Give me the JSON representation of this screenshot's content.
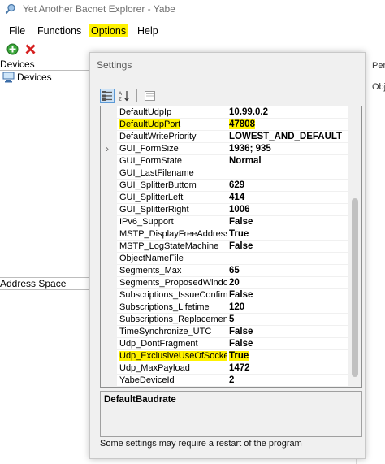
{
  "window": {
    "title": "Yet Another Bacnet Explorer - Yabe"
  },
  "menu": {
    "items": [
      {
        "label": "File",
        "highlighted": false
      },
      {
        "label": "Functions",
        "highlighted": false
      },
      {
        "label": "Options",
        "highlighted": true
      },
      {
        "label": "Help",
        "highlighted": false
      }
    ]
  },
  "toolbar": {
    "icons": [
      "add-icon",
      "delete-icon"
    ]
  },
  "left_panel": {
    "devices_header": "Devices",
    "devices_item": "Devices",
    "address_space_header": "Address Space"
  },
  "right_edge": {
    "caption_1": "Pen",
    "caption_2": "Obj"
  },
  "dialog": {
    "title": "Settings",
    "toolbar_icons": [
      "categorized-icon",
      "alphabetical-sort-icon",
      "property-pages-icon"
    ],
    "properties": [
      {
        "name": "DefaultUdpIp",
        "value": "10.99.0.2",
        "highlight": false,
        "expandable": false
      },
      {
        "name": "DefaultUdpPort",
        "value": "47808",
        "highlight": true,
        "expandable": false
      },
      {
        "name": "DefaultWritePriority",
        "value": "LOWEST_AND_DEFAULT",
        "highlight": false,
        "expandable": false
      },
      {
        "name": "GUI_FormSize",
        "value": "1936; 935",
        "highlight": false,
        "expandable": true
      },
      {
        "name": "GUI_FormState",
        "value": "Normal",
        "highlight": false,
        "expandable": false
      },
      {
        "name": "GUI_LastFilename",
        "value": "",
        "highlight": false,
        "expandable": false
      },
      {
        "name": "GUI_SplitterButtom",
        "value": "629",
        "highlight": false,
        "expandable": false
      },
      {
        "name": "GUI_SplitterLeft",
        "value": "414",
        "highlight": false,
        "expandable": false
      },
      {
        "name": "GUI_SplitterRight",
        "value": "1006",
        "highlight": false,
        "expandable": false
      },
      {
        "name": "IPv6_Support",
        "value": "False",
        "highlight": false,
        "expandable": false
      },
      {
        "name": "MSTP_DisplayFreeAddresses",
        "value": "True",
        "highlight": false,
        "expandable": false
      },
      {
        "name": "MSTP_LogStateMachine",
        "value": "False",
        "highlight": false,
        "expandable": false
      },
      {
        "name": "ObjectNameFile",
        "value": "",
        "highlight": false,
        "expandable": false
      },
      {
        "name": "Segments_Max",
        "value": "65",
        "highlight": false,
        "expandable": false
      },
      {
        "name": "Segments_ProposedWindow",
        "value": "20",
        "highlight": false,
        "expandable": false
      },
      {
        "name": "Subscriptions_IssueConfirmedNotifies",
        "value": "False",
        "highlight": false,
        "expandable": false
      },
      {
        "name": "Subscriptions_Lifetime",
        "value": "120",
        "highlight": false,
        "expandable": false
      },
      {
        "name": "Subscriptions_ReplacementPollingPeriod",
        "value": "5",
        "highlight": false,
        "expandable": false
      },
      {
        "name": "TimeSynchronize_UTC",
        "value": "False",
        "highlight": false,
        "expandable": false
      },
      {
        "name": "Udp_DontFragment",
        "value": "False",
        "highlight": false,
        "expandable": false
      },
      {
        "name": "Udp_ExclusiveUseOfSocket",
        "value": "True",
        "highlight": true,
        "expandable": false
      },
      {
        "name": "Udp_MaxPayload",
        "value": "1472",
        "highlight": false,
        "expandable": false
      },
      {
        "name": "YabeDeviceId",
        "value": "2",
        "highlight": false,
        "expandable": false
      }
    ],
    "description_title": "DefaultBaudrate",
    "footer_note": "Some settings may require a restart of the program"
  },
  "colors": {
    "highlight": "#fff200",
    "selected_button": "#cfe3f5"
  }
}
